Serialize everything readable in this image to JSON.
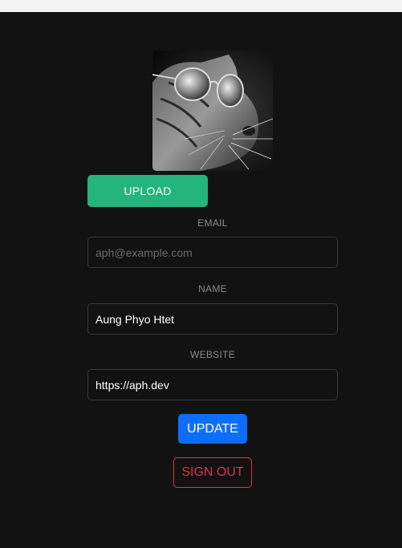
{
  "profile": {
    "avatar_alt": "cat-with-sunglasses-photo",
    "upload_label": "UPLOAD"
  },
  "form": {
    "email": {
      "label": "EMAIL",
      "value": "",
      "placeholder": "aph@example.com"
    },
    "name": {
      "label": "NAME",
      "value": "Aung Phyo Htet",
      "placeholder": ""
    },
    "website": {
      "label": "WEBSITE",
      "value": "https://aph.dev",
      "placeholder": ""
    }
  },
  "actions": {
    "update_label": "UPDATE",
    "signout_label": "SIGN OUT"
  },
  "colors": {
    "background": "#121212",
    "upload": "#24b47e",
    "update": "#0d6efd",
    "signout": "#dc3545"
  }
}
